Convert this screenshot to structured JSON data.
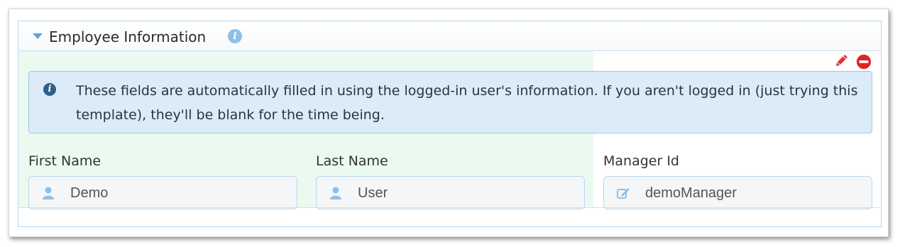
{
  "panel": {
    "title": "Employee Information",
    "title_info_glyph": "i",
    "collapse_icon": "caret-down-icon",
    "actions": {
      "edit_icon": "pencil-icon",
      "remove_icon": "minus-circle-icon"
    },
    "colors": {
      "accent": "#5fa4d8",
      "body_background": "#eafaf0",
      "alert_background": "#dcebf8",
      "edit": "#e8312f",
      "remove": "#e02424"
    }
  },
  "alert": {
    "icon": "info-circle-icon",
    "glyph": "i",
    "text": "These fields are automatically filled in using the logged-in user's information. If you aren't logged in (just trying this template), they'll be blank for the time being."
  },
  "fields": [
    {
      "label": "First Name",
      "value": "Demo",
      "icon": "user-icon"
    },
    {
      "label": "Last Name",
      "value": "User",
      "icon": "user-icon"
    },
    {
      "label": "Manager Id",
      "value": "demoManager",
      "icon": "edit-icon"
    }
  ]
}
